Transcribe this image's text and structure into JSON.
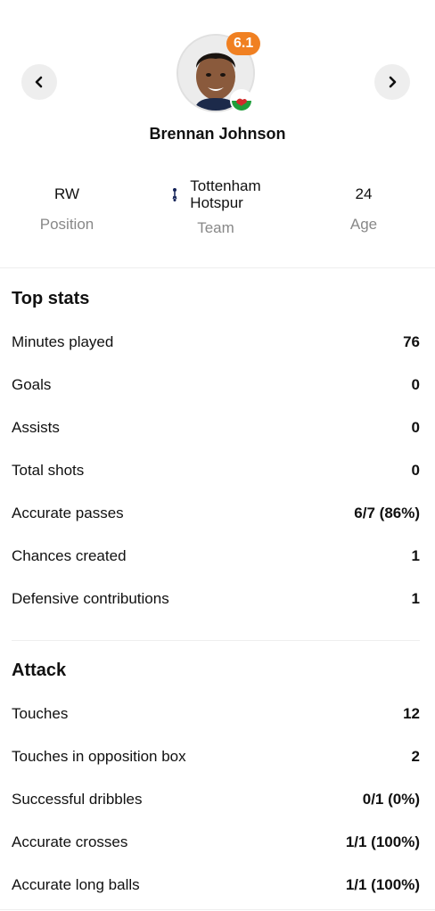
{
  "player": {
    "name": "Brennan Johnson",
    "rating": "6.1",
    "flag_icon": "wales-flag-icon",
    "rating_color": "#f08022"
  },
  "nav": {
    "prev_icon": "chevron-left-icon",
    "next_icon": "chevron-right-icon"
  },
  "info": {
    "position_value": "RW",
    "position_label": "Position",
    "team_line1": "Tottenham",
    "team_line2": "Hotspur",
    "team_label": "Team",
    "age_value": "24",
    "age_label": "Age"
  },
  "top_stats": {
    "title": "Top stats",
    "rows": [
      {
        "label": "Minutes played",
        "value": "76"
      },
      {
        "label": "Goals",
        "value": "0"
      },
      {
        "label": "Assists",
        "value": "0"
      },
      {
        "label": "Total shots",
        "value": "0"
      },
      {
        "label": "Accurate passes",
        "value": "6/7 (86%)"
      },
      {
        "label": "Chances created",
        "value": "1"
      },
      {
        "label": "Defensive contributions",
        "value": "1"
      }
    ]
  },
  "attack": {
    "title": "Attack",
    "rows": [
      {
        "label": "Touches",
        "value": "12"
      },
      {
        "label": "Touches in opposition box",
        "value": "2"
      },
      {
        "label": "Successful dribbles",
        "value": "0/1 (0%)"
      },
      {
        "label": "Accurate crosses",
        "value": "1/1 (100%)"
      },
      {
        "label": "Accurate long balls",
        "value": "1/1 (100%)"
      }
    ]
  }
}
